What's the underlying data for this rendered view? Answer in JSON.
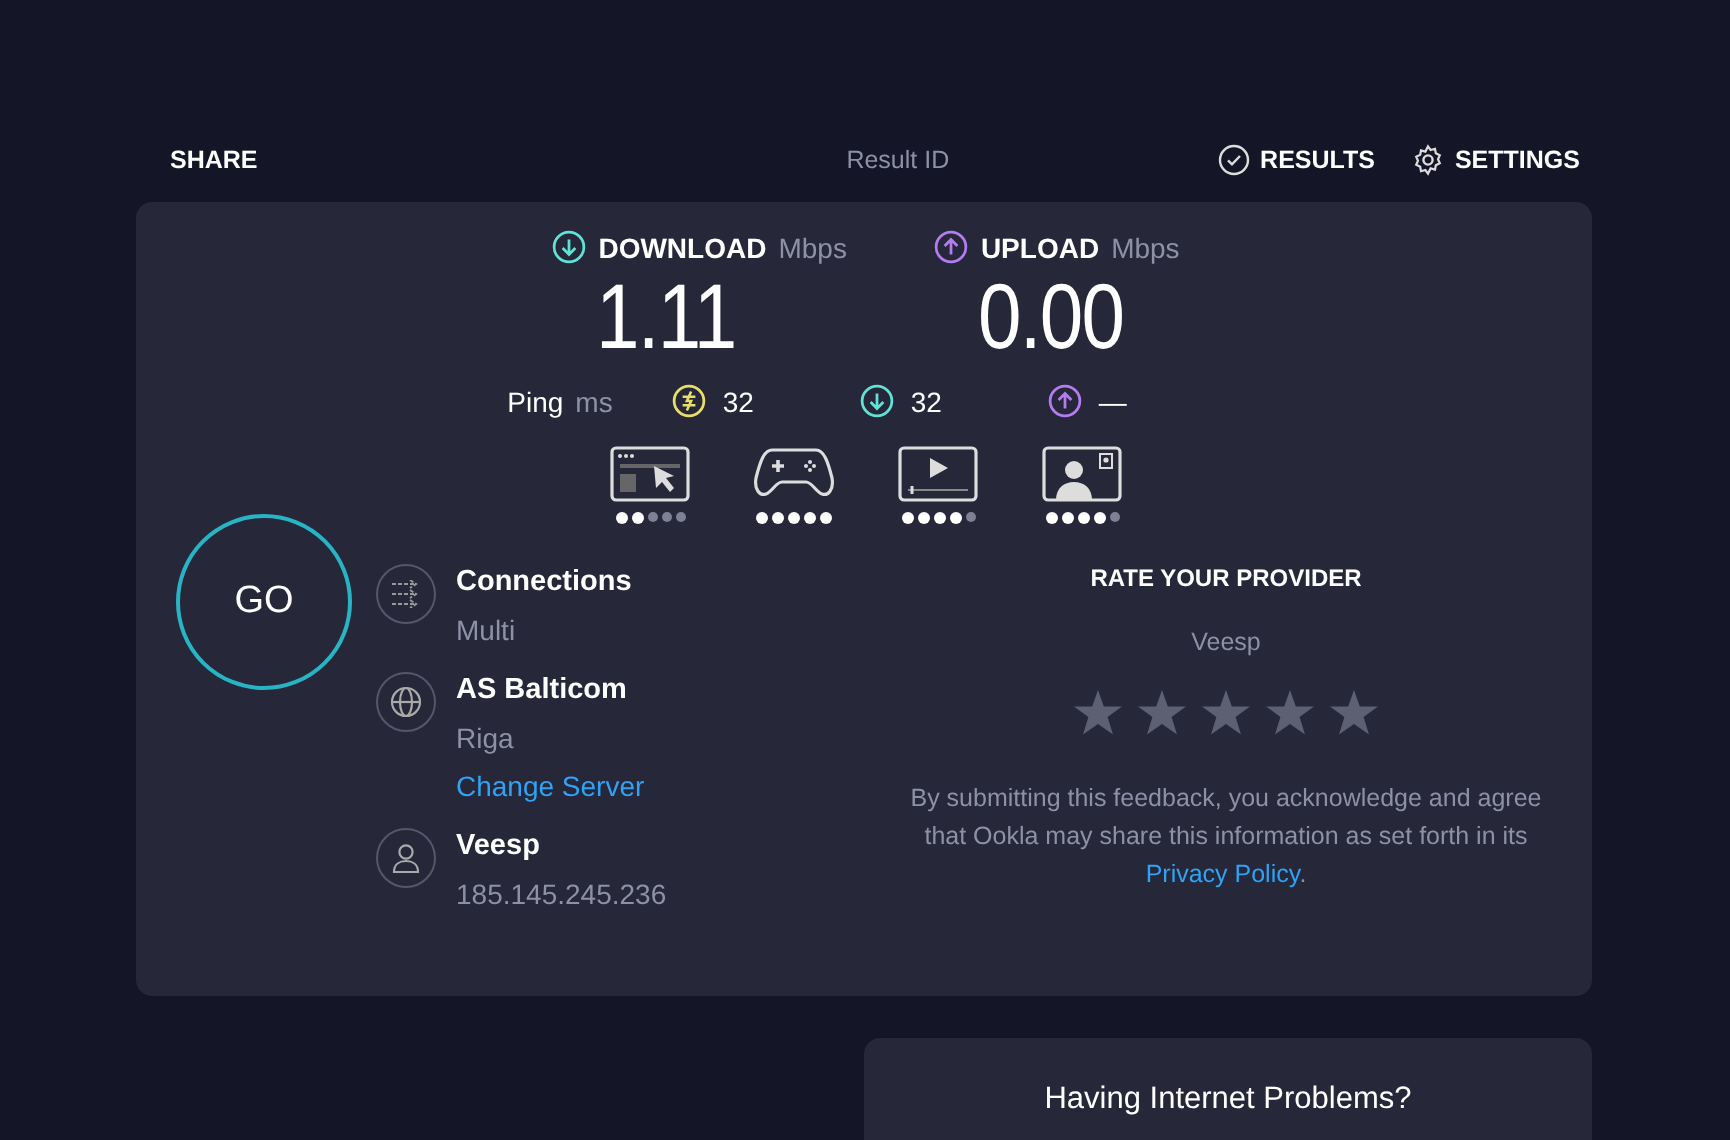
{
  "header": {
    "share": "SHARE",
    "result_id": "Result ID",
    "results": "RESULTS",
    "settings": "SETTINGS"
  },
  "speeds": [
    {
      "kind": "download",
      "label": "DOWNLOAD",
      "unit": "Mbps",
      "value": "1.11",
      "color": "#5fe3d6"
    },
    {
      "kind": "upload",
      "label": "UPLOAD",
      "unit": "Mbps",
      "value": "0.00",
      "color": "#b57cf0"
    }
  ],
  "ping": {
    "label": "Ping",
    "unit": "ms",
    "readings": [
      {
        "kind": "idle",
        "value": "32",
        "color": "#e8de6a"
      },
      {
        "kind": "download",
        "value": "32",
        "color": "#5fe3d6"
      },
      {
        "kind": "upload",
        "value": "—",
        "color": "#b57cf0"
      }
    ]
  },
  "activities": [
    {
      "kind": "browsing",
      "stars": 2
    },
    {
      "kind": "gaming",
      "stars": 5
    },
    {
      "kind": "streaming",
      "stars": 4
    },
    {
      "kind": "video-call",
      "stars": 4
    }
  ],
  "go": "GO",
  "info": [
    {
      "kind": "connections",
      "title": "Connections",
      "lines": [
        "Multi"
      ]
    },
    {
      "kind": "server",
      "title": "AS Balticom",
      "lines": [
        "Riga"
      ],
      "link": "Change Server"
    },
    {
      "kind": "provider",
      "title": "Veesp",
      "lines": [
        "185.145.245.236"
      ]
    }
  ],
  "rating": {
    "title": "RATE YOUR PROVIDER",
    "provider": "Veesp",
    "stars": 0,
    "note": "By submitting this feedback, you acknowledge and agree that Ookla may share this information as set forth in its",
    "link": "Privacy Policy",
    "after": "."
  },
  "help": {
    "title": "Having Internet Problems?"
  }
}
